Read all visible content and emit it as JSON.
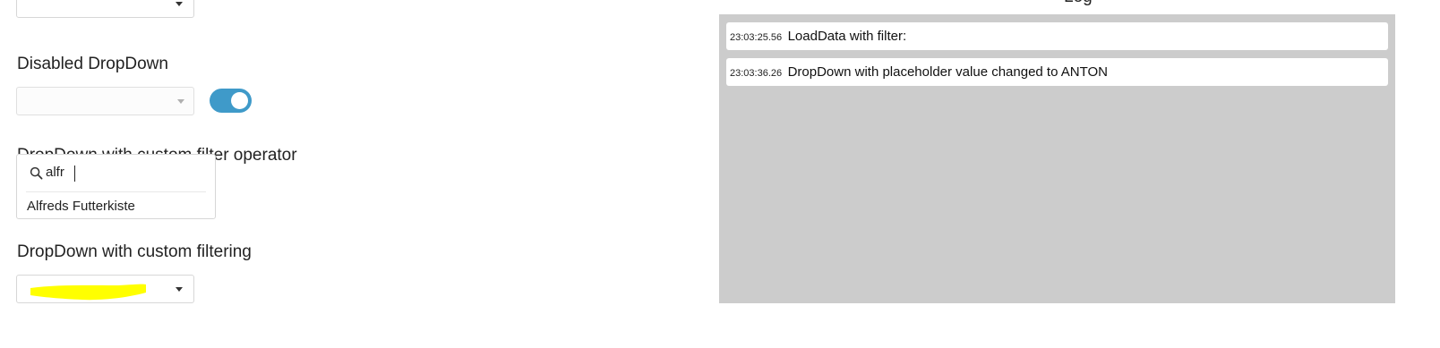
{
  "left": {
    "disabled_dropdown": {
      "label": "Disabled DropDown",
      "toggle_on": true
    },
    "custom_filter_operator": {
      "label": "DropDown with custom filter operator",
      "search_value": "alfr",
      "option": "Alfreds Futterkiste"
    },
    "custom_filtering": {
      "label": "DropDown with custom filtering",
      "highlight_color": "#ffff00"
    }
  },
  "log": {
    "title": "Log",
    "entries": [
      {
        "time": "23:03:25.56",
        "message": "LoadData with filter:"
      },
      {
        "time": "23:03:36.26",
        "message": "DropDown with placeholder value changed to ANTON"
      }
    ]
  },
  "colors": {
    "toggle": "#3f9ac9",
    "log_panel": "#cccccc"
  }
}
